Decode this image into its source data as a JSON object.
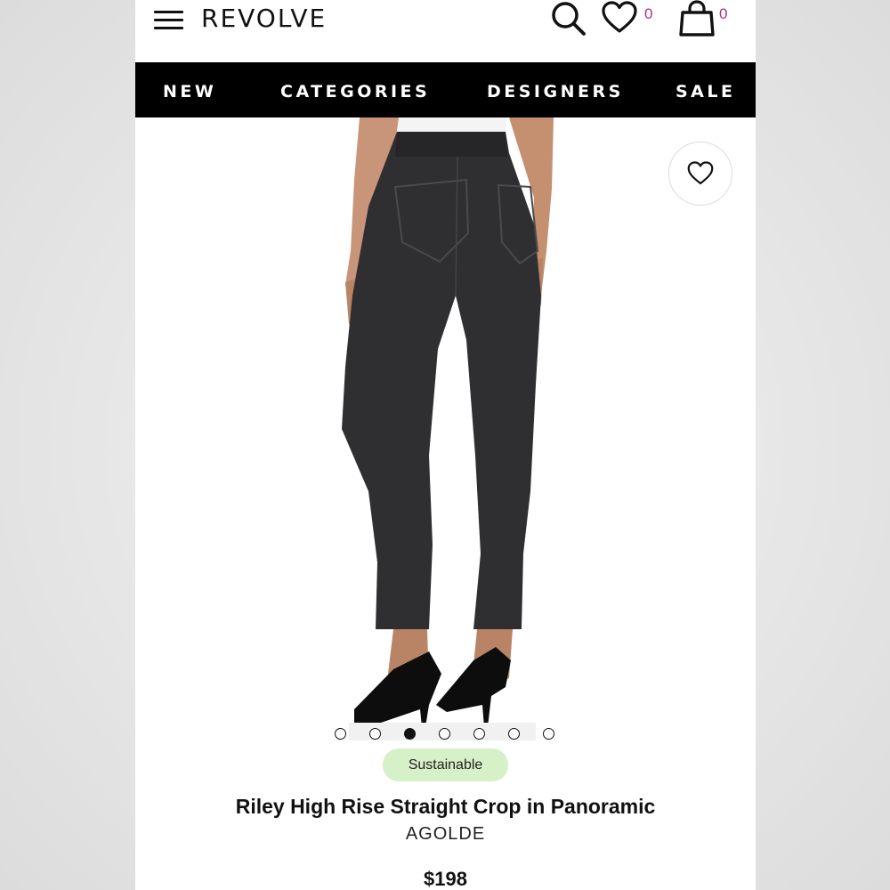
{
  "header": {
    "logo": "REVOLVE",
    "wishlist_count": "0",
    "cart_count": "0",
    "count_color": "#b0307a",
    "icons": [
      "hamburger-menu-icon",
      "search-icon",
      "heart-icon",
      "shopping-bag-icon"
    ]
  },
  "nav": {
    "items": [
      {
        "label": "NEW"
      },
      {
        "label": "CATEGORIES"
      },
      {
        "label": "DESIGNERS"
      },
      {
        "label": "SALE"
      }
    ]
  },
  "carousel": {
    "image_count": 7,
    "active_index": 2
  },
  "product": {
    "badge": "Sustainable",
    "badge_color": "#d6f0c8",
    "title": "Riley High Rise Straight Crop in Panoramic",
    "brand": "AGOLDE",
    "price": "$198"
  }
}
